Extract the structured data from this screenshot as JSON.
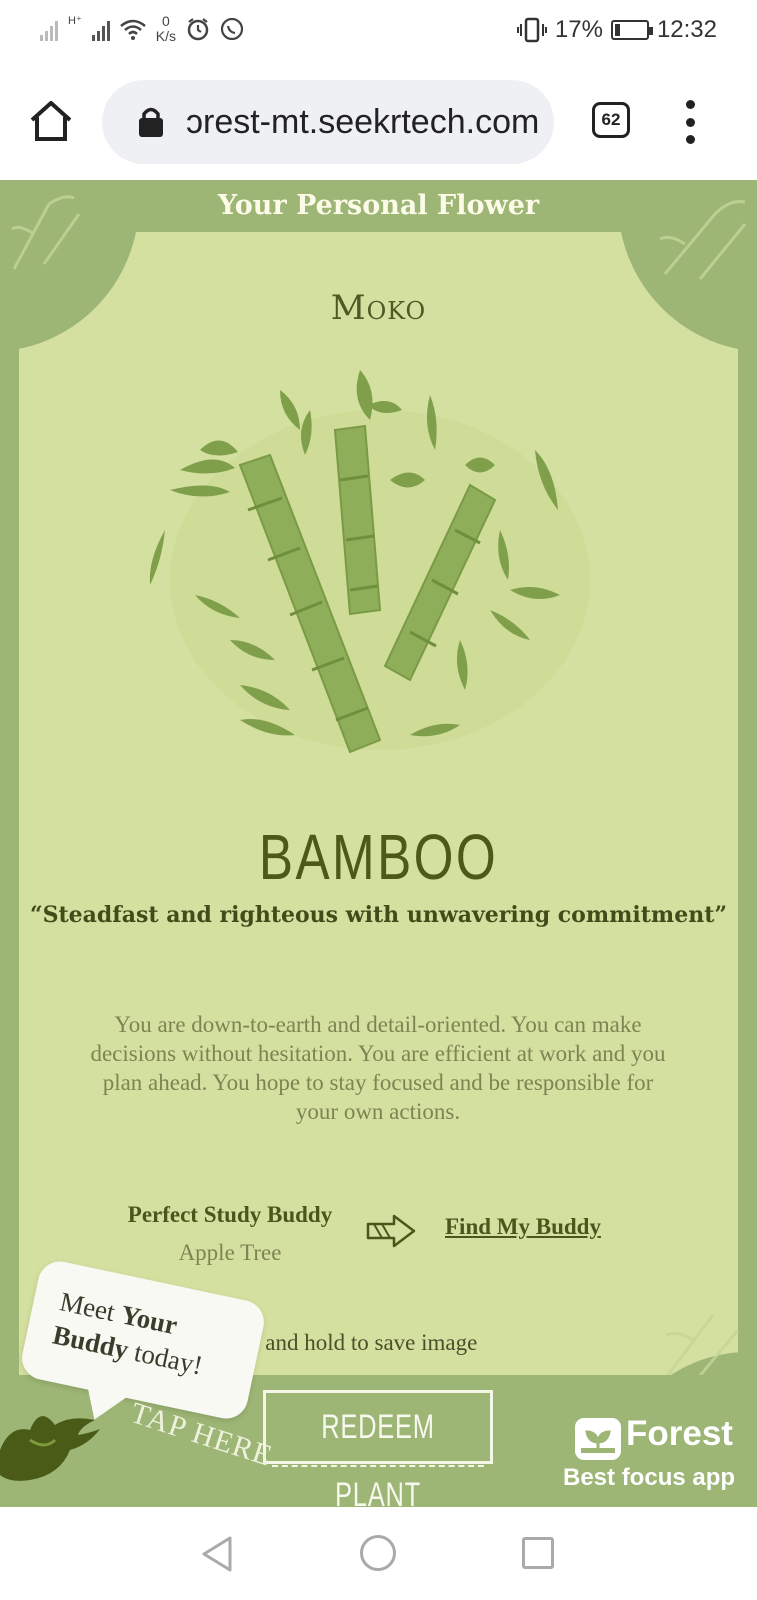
{
  "status_bar": {
    "speed_value": "0",
    "speed_unit": "K/s",
    "hplus_label": "H⁺",
    "battery_percent": "17%",
    "battery_level": 0.17,
    "time": "12:32",
    "icons": [
      "signal-no-sim-icon",
      "signal-hplus-icon",
      "wifi-icon",
      "alarm-icon",
      "whatsapp-icon",
      "vibrate-icon",
      "battery-charging-icon"
    ]
  },
  "browser": {
    "url": "ɔrest-mt.seekrtech.com",
    "tab_count": "62"
  },
  "card": {
    "header_title": "Your Personal Flower",
    "owner_name": "Moko",
    "plant_name": "BAMBOO",
    "quote": "“Steadfast and righteous with unwavering commitment”",
    "description": "You are down-to-earth and detail-oriented. You can make decisions without hesitation. You are efficient at work and you plan ahead. You hope to stay focused and be responsible for your own actions.",
    "buddy_title": "Perfect Study Buddy",
    "buddy_name": "Apple Tree",
    "find_buddy_label": "Find My Buddy",
    "save_hint": "p and hold to save image",
    "bubble_line1": "Meet",
    "bubble_your": "Your",
    "bubble_buddy": "Buddy",
    "bubble_today": "today!",
    "tap_here": "TAP HERE",
    "redeem_label": "REDEEM PLANT",
    "brand_name": "Forest",
    "brand_tagline": "Best focus app",
    "colors": {
      "panel": "#d4e09f",
      "frame": "#9db575",
      "accent": "#4a5a17"
    }
  },
  "nav_bar": {
    "icons": [
      "back-icon",
      "home-circle-icon",
      "recents-square-icon"
    ]
  }
}
